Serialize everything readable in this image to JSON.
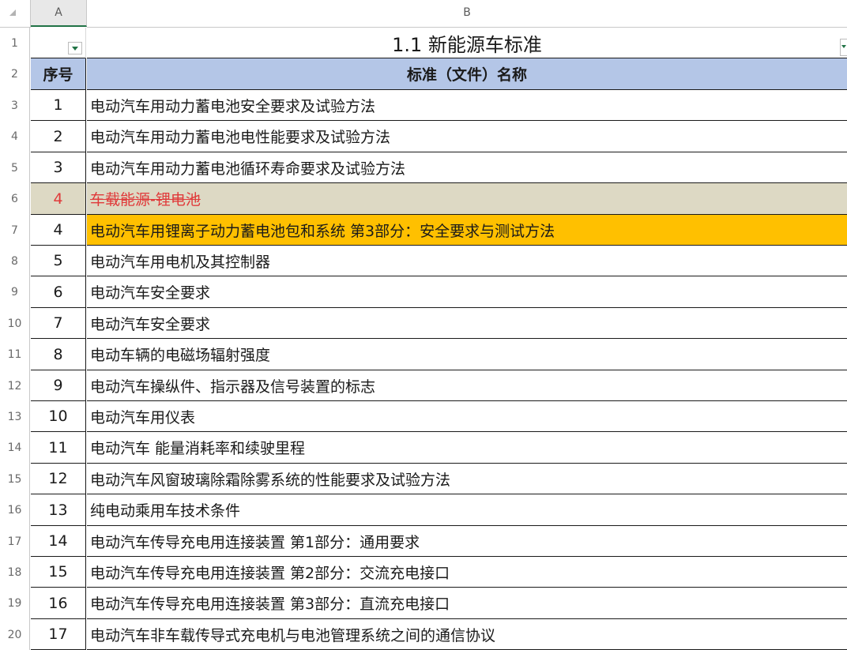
{
  "columns": {
    "a": "A",
    "b": "B"
  },
  "title": "1.1  新能源车标准",
  "header": {
    "no": "序号",
    "name": "标准（文件）名称"
  },
  "row_numbers": [
    "1",
    "2",
    "3",
    "4",
    "5",
    "6",
    "7",
    "8",
    "9",
    "10",
    "11",
    "12",
    "13",
    "14",
    "15",
    "16",
    "17",
    "18",
    "19",
    "20"
  ],
  "rows": [
    {
      "no": "1",
      "name": "电动汽车用动力蓄电池安全要求及试验方法"
    },
    {
      "no": "2",
      "name": "电动汽车用动力蓄电池电性能要求及试验方法"
    },
    {
      "no": "3",
      "name": "电动汽车用动力蓄电池循环寿命要求及试验方法"
    },
    {
      "no": "4",
      "name": "车载能源-锂电池",
      "style": "struck"
    },
    {
      "no": "4",
      "name": "电动汽车用锂离子动力蓄电池包和系统  第3部分：安全要求与测试方法",
      "style": "highlight"
    },
    {
      "no": "5",
      "name": "电动汽车用电机及其控制器"
    },
    {
      "no": "6",
      "name": "电动汽车安全要求"
    },
    {
      "no": "7",
      "name": "电动汽车安全要求"
    },
    {
      "no": "8",
      "name": "电动车辆的电磁场辐射强度"
    },
    {
      "no": "9",
      "name": "电动汽车操纵件、指示器及信号装置的标志"
    },
    {
      "no": "10",
      "name": "电动汽车用仪表"
    },
    {
      "no": "11",
      "name": "电动汽车 能量消耗率和续驶里程"
    },
    {
      "no": "12",
      "name": "电动汽车风窗玻璃除霜除雾系统的性能要求及试验方法"
    },
    {
      "no": "13",
      "name": "纯电动乘用车技术条件"
    },
    {
      "no": "14",
      "name": "电动汽车传导充电用连接装置 第1部分：通用要求"
    },
    {
      "no": "15",
      "name": "电动汽车传导充电用连接装置 第2部分：交流充电接口"
    },
    {
      "no": "16",
      "name": "电动汽车传导充电用连接装置 第3部分：直流充电接口"
    },
    {
      "no": "17",
      "name": "电动汽车非车载传导式充电机与电池管理系统之间的通信协议"
    }
  ],
  "colors": {
    "header_fill": "#b4c6e7",
    "highlight_fill": "#ffc000",
    "struck_fill": "#ddd9c4",
    "struck_text": "#e03a3a"
  }
}
